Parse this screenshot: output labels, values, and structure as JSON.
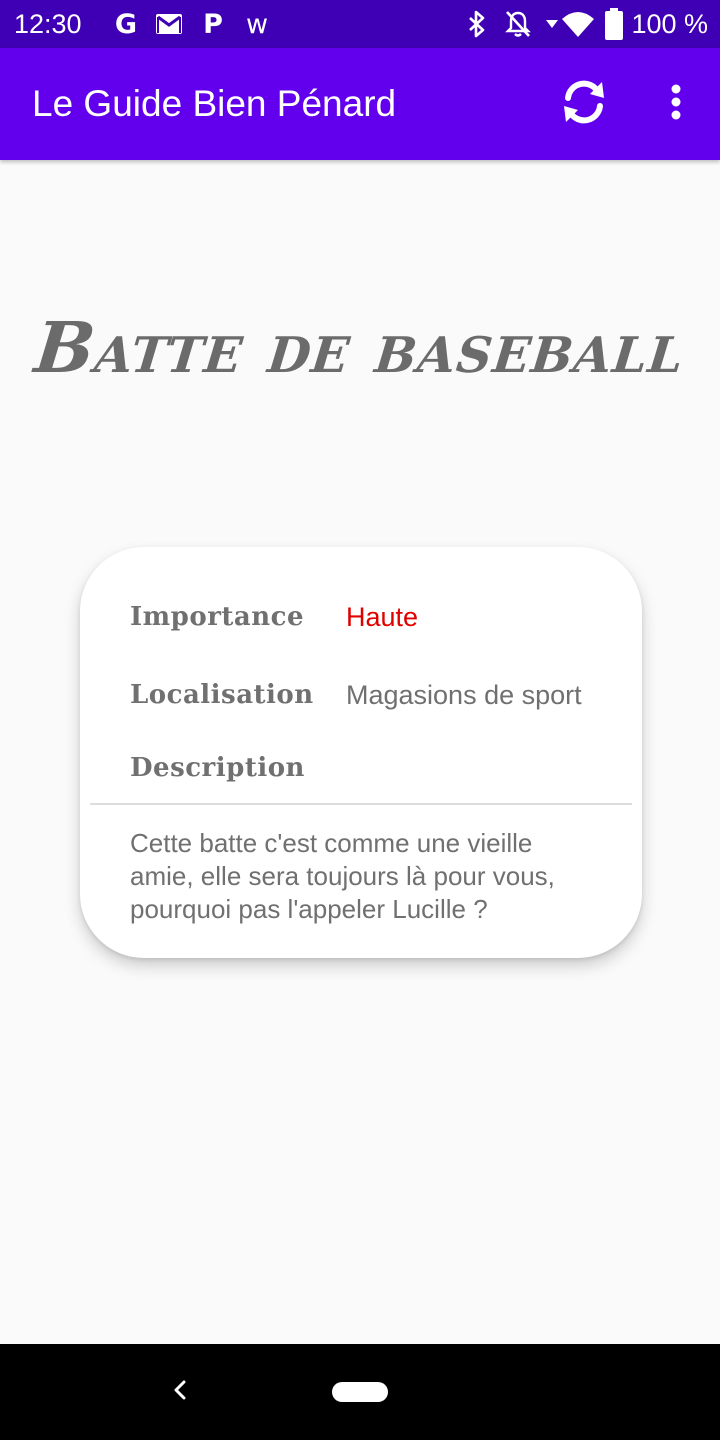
{
  "status_bar": {
    "time": "12:30",
    "notification_icons": [
      "G",
      "gmail-icon",
      "P",
      "w"
    ],
    "battery_text": "100 %",
    "icons": [
      "bluetooth-icon",
      "notifications-off-icon",
      "data-arrow-icon",
      "wifi-icon",
      "battery-icon"
    ]
  },
  "app_bar": {
    "title": "Le Guide Bien Pénard",
    "refresh_icon": "refresh-icon",
    "overflow_icon": "more-vert-icon",
    "color": "#6200ee"
  },
  "item": {
    "title": "Batte de baseball"
  },
  "card": {
    "importance_label": "Importance",
    "importance_value": "Haute",
    "importance_color": "#e00000",
    "location_label": "Localisation",
    "location_value": "Magasions de sport",
    "description_label": "Description",
    "description_text": "Cette batte c'est comme une vieille amie, elle sera toujours là pour vous, pourquoi pas l'appeler Lucille ?"
  },
  "nav_bar": {
    "back_icon": "back-icon",
    "home_icon": "home-pill-icon"
  }
}
